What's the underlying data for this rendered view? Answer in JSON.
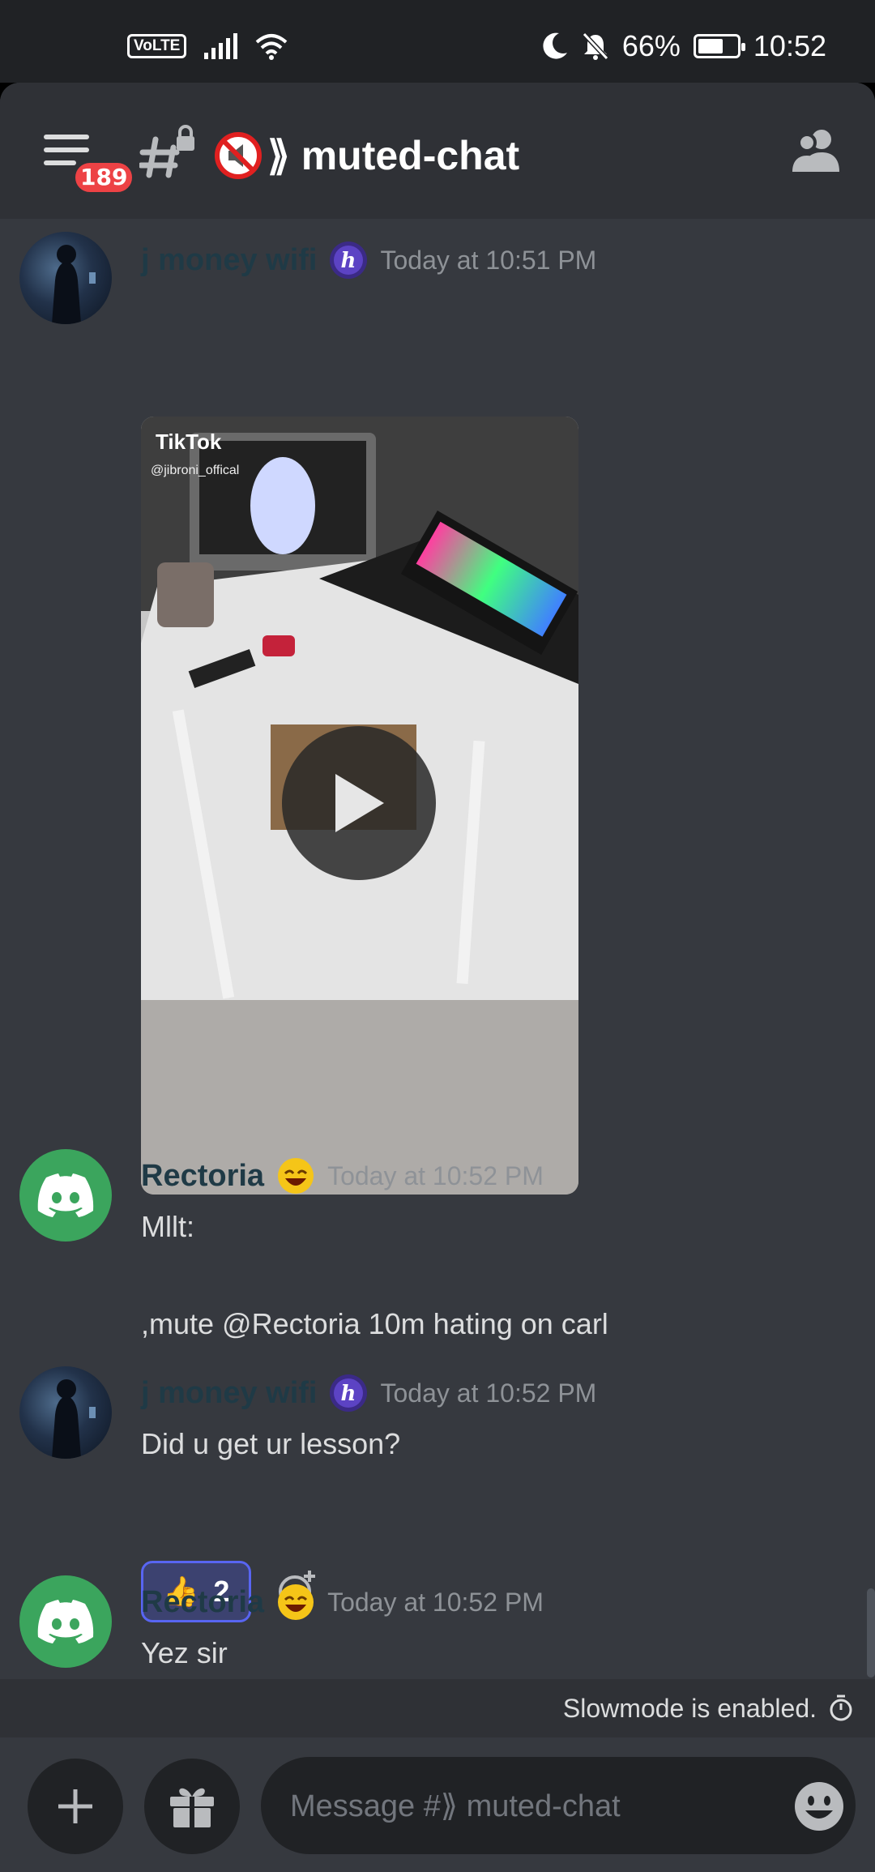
{
  "status_bar": {
    "volte": "VoLTE",
    "battery": "66%",
    "battery_level": 0.66,
    "time": "10:52"
  },
  "header": {
    "badge_count": "189",
    "channel_name": "⟫⟪muted-chat",
    "channel_name_display": "⟫ muted-chat"
  },
  "messages": [
    {
      "username": "j money wifi",
      "timestamp": "Today at 10:51 PM",
      "embed": {
        "provider": "TikTok",
        "author": "@jibroni_offical"
      }
    },
    {
      "username": "Rectoria",
      "timestamp": "Today at 10:52 PM",
      "lines": [
        "Mllt:",
        ",mute @Rectoria 10m hating on carl"
      ]
    },
    {
      "username": "j money wifi",
      "timestamp": "Today at 10:52 PM",
      "text": "Did u get ur lesson?",
      "reaction": {
        "emoji": "👍",
        "count": "2"
      }
    },
    {
      "username": "Rectoria",
      "timestamp": "Today at 10:52 PM",
      "text": "Yez sir"
    }
  ],
  "slowmode": {
    "text": "Slowmode is enabled."
  },
  "composer": {
    "placeholder": "Message #⟫ muted-chat"
  },
  "colors": {
    "background": "#36393f",
    "header_bg": "#2f3136",
    "accent": "#5865f2",
    "badge": "#ed4245",
    "discord_green": "#3ba55d"
  },
  "icons": [
    "hamburger-icon",
    "text-channel-lock-icon",
    "muted-speaker-icon",
    "members-icon",
    "play-icon",
    "add-reaction-icon",
    "plus-icon",
    "gift-icon",
    "emoji-icon",
    "timer-icon"
  ]
}
